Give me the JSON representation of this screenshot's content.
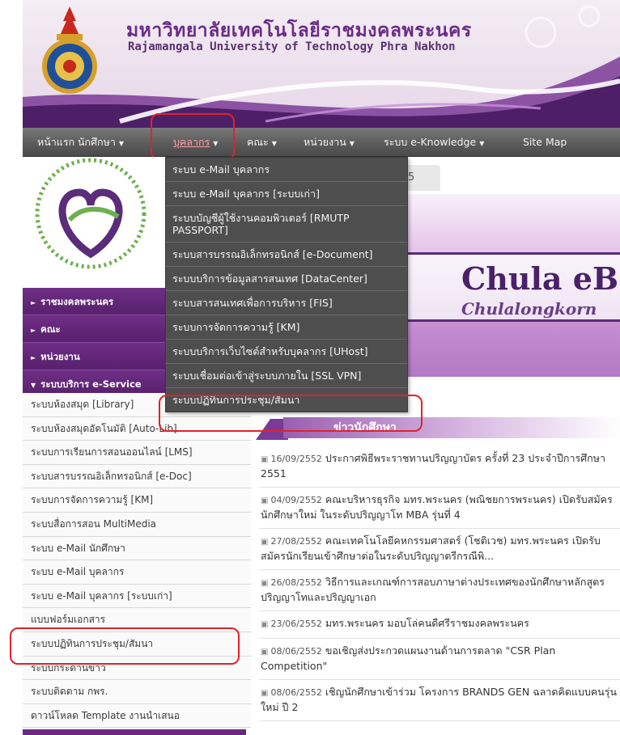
{
  "header": {
    "title_th": "มหาวิทยาลัยเทคโนโลยีราชมงคลพระนคร",
    "title_en": "Rajamangala University of Technology Phra Nakhon",
    "logo_icon": "university-seal-icon"
  },
  "nav": {
    "items": [
      {
        "label": "หน้าแรก",
        "has_caret": false
      },
      {
        "label": "นักศึกษา",
        "has_caret": true
      },
      {
        "label": "บุคลากร",
        "has_caret": true
      },
      {
        "label": "คณะ",
        "has_caret": true
      },
      {
        "label": "หน่วยงาน",
        "has_caret": true
      },
      {
        "label": "ระบบ e-Knowledge",
        "has_caret": true
      },
      {
        "label": "Site Map",
        "has_caret": false
      }
    ],
    "caret": "▼"
  },
  "dropdown": {
    "items": [
      "ระบบ e-Mail บุคลากร",
      "ระบบ e-Mail บุคลากร [ระบบเก่า]",
      "ระบบบัญชีผู้ใช้งานคอมพิวเตอร์ [RMUTP PASSPORT]",
      "ระบบสารบรรณอิเล็กทรอนิกส์ [e-Document]",
      "ระบบบริการข้อมูลสารสนเทศ [DataCenter]",
      "ระบบสารสนเทศเพื่อการบริหาร [FIS]",
      "ระบบการจัดการความรู้ [KM]",
      "ระบบบริการเว็บไซต์สำหรับบุคลากร [UHost]",
      "ระบบเชื่อมต่อเข้าสู่ระบบภายใน [SSL VPN]",
      "ระบบปฏิทินการประชุม/สัมนา"
    ]
  },
  "tab": {
    "label": "5"
  },
  "sidemenu": {
    "items": [
      {
        "label": "ราชมงคลพระนคร",
        "arrow": "►"
      },
      {
        "label": "คณะ",
        "arrow": "►"
      },
      {
        "label": "หน่วยงาน",
        "arrow": "►"
      },
      {
        "label": "ระบบบริการ e-Service",
        "arrow": "▼"
      }
    ]
  },
  "services": {
    "items": [
      "ระบบห้องสมุด [Library]",
      "ระบบห้องสมุดอัตโนมัติ [Auto-Lib]",
      "ระบบการเรียนการสอนออนไลน์ [LMS]",
      "ระบบสารบรรณอิเล็กทรอนิกส์ [e-Doc]",
      "ระบบการจัดการความรู้ [KM]",
      "ระบบสื่อการสอน MultiMedia",
      "ระบบ e-Mail นักศึกษา",
      "ระบบ e-Mail บุคลากร",
      "ระบบ e-Mail บุคลากร [ระบบเก่า]",
      "แบบฟอร์มเอกสาร",
      "ระบบปฏิทินการประชุม/สัมนา",
      "ระบบกระดานข่าว",
      "ระบบติดตาม กพร.",
      "ดาวน์โหลด Template งานนำเสนอ"
    ]
  },
  "banner": {
    "title": "Chula eB",
    "subtitle": "Chulalongkorn"
  },
  "news": {
    "heading": "ข่าวนักศึกษา",
    "bullet_icon": "news-bullet-icon",
    "items": [
      {
        "date": "16/09/2552",
        "text": "ประกาศพิธีพระราชทานปริญญาบัตร ครั้งที่ 23 ประจำปีการศึกษา 2551"
      },
      {
        "date": "04/09/2552",
        "text": "คณะบริหารธุรกิจ มทร.พระนคร (พณิชยการพระนคร) เปิดรับสมัครนักศึกษาใหม่ ในระดับปริญญาโท MBA รุ่นที่ 4"
      },
      {
        "date": "27/08/2552",
        "text": "คณะเทคโนโลยีคหกรรมศาสตร์ (โชติเวช) มทร.พระนคร เปิดรับสมัครนักเรียนเข้าศึกษาต่อในระดับปริญญาตรีกรณีพิ..."
      },
      {
        "date": "26/08/2552",
        "text": "วิธีการและเกณฑ์การสอบภาษาต่างประเทศของนักศึกษาหลักสูตรปริญญาโทและปริญญาเอก"
      },
      {
        "date": "23/06/2552",
        "text": "มทร.พระนคร มอบโล่คนดีศรีราชมงคลพระนคร"
      },
      {
        "date": "08/06/2552",
        "text": "ขอเชิญส่งประกวดแผนงานด้านการตลาด \"CSR Plan Competition\""
      },
      {
        "date": "08/06/2552",
        "text": "เชิญนักศึกษาเข้าร่วม โครงการ BRANDS GEN ฉลาดคิดแบบคนรุ่นใหม่ ปี 2"
      }
    ]
  },
  "colors": {
    "accent_purple": "#6f2e86",
    "highlight_red": "#e0222a",
    "nav_gray": "#5e5e5e"
  }
}
